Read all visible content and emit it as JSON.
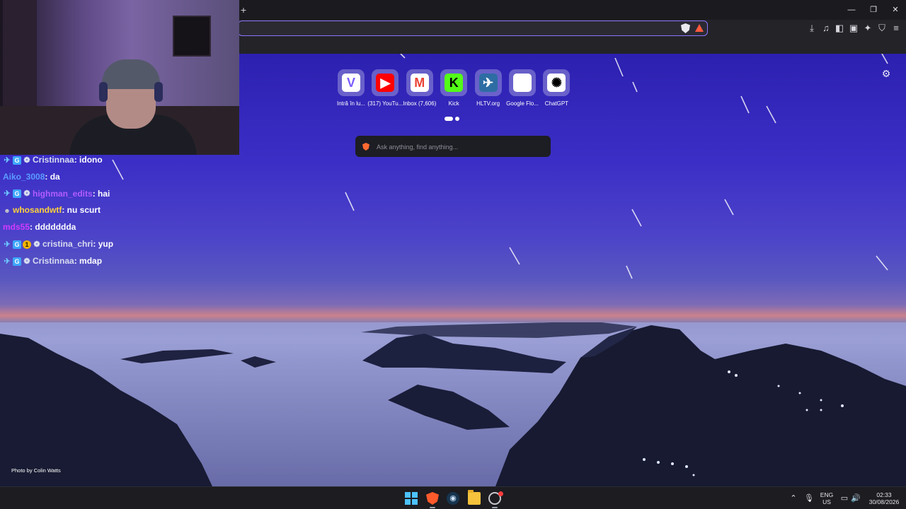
{
  "browser": {
    "new_tab_glyph": "+",
    "window_controls": {
      "minimize": "—",
      "restore": "❐",
      "close": "✕"
    },
    "addressbar_placeholder": "",
    "toolbar_icons": [
      "download-icon",
      "music-icon",
      "sidebar-icon",
      "wallet-icon",
      "leo-icon",
      "vpn-shield-icon",
      "menu-icon"
    ]
  },
  "ntp": {
    "shortcuts": [
      {
        "label": "Intră în lu...",
        "glyph": "V",
        "glyph_color": "#7c5cff",
        "tile_bg": "#ffffff"
      },
      {
        "label": "(317) YouTu...",
        "glyph": "▶",
        "glyph_color": "#ffffff",
        "tile_bg": "#ff0000"
      },
      {
        "label": "Inbox (7,606)",
        "glyph": "M",
        "glyph_color": "#ea4335",
        "tile_bg": "#ffffff"
      },
      {
        "label": "Kick",
        "glyph": "K",
        "glyph_color": "#000000",
        "tile_bg": "#53fc18"
      },
      {
        "label": "HLTV.org",
        "glyph": "✈",
        "glyph_color": "#ffffff",
        "tile_bg": "#2d6da3"
      },
      {
        "label": "Google Flo...",
        "glyph": "",
        "glyph_color": "#ffffff",
        "tile_bg": "#ffffff"
      },
      {
        "label": "ChatGPT",
        "glyph": "✺",
        "glyph_color": "#000000",
        "tile_bg": "#ffffff"
      }
    ],
    "search_placeholder": "Ask anything, find anything...",
    "photo_credit": "Photo by Colin Watts",
    "settings_glyph": "⚙"
  },
  "chat": [
    {
      "badges": [
        "sword",
        "sub",
        "gear"
      ],
      "user": "Cristinnaa",
      "user_color": "#d7dcef",
      "message": "idono"
    },
    {
      "badges": [],
      "user": "Aiko_3008",
      "user_color": "#5b9bff",
      "message": "da"
    },
    {
      "badges": [
        "sword",
        "sub",
        "gear"
      ],
      "user": "highman_edits",
      "user_color": "#b25cff",
      "message": "hai"
    },
    {
      "badges": [
        "user"
      ],
      "user": "whosandwtf",
      "user_color": "#ffd23a",
      "message": "nu scurt"
    },
    {
      "badges": [],
      "user": "mds55",
      "user_color": "#d23bff",
      "message": "ddddddda"
    },
    {
      "badges": [
        "sword",
        "sub",
        "one",
        "gear"
      ],
      "user": "cristina_chri",
      "user_color": "#d7dcef",
      "message": "yup"
    },
    {
      "badges": [
        "sword",
        "sub",
        "gear"
      ],
      "user": "Cristinnaa",
      "user_color": "#d7dcef",
      "message": "mdap"
    }
  ],
  "badge_glyphs": {
    "sword": "✈",
    "sub": "G",
    "gear": "❁",
    "one": "1",
    "user": "☻"
  },
  "taskbar": {
    "language": "ENG",
    "region": "US",
    "time": "02:33",
    "date": "30/08/2026",
    "tray_chevron": "⌃",
    "mic_glyph": "🎙",
    "network_glyph": "▭",
    "volume_glyph": "🔊"
  }
}
